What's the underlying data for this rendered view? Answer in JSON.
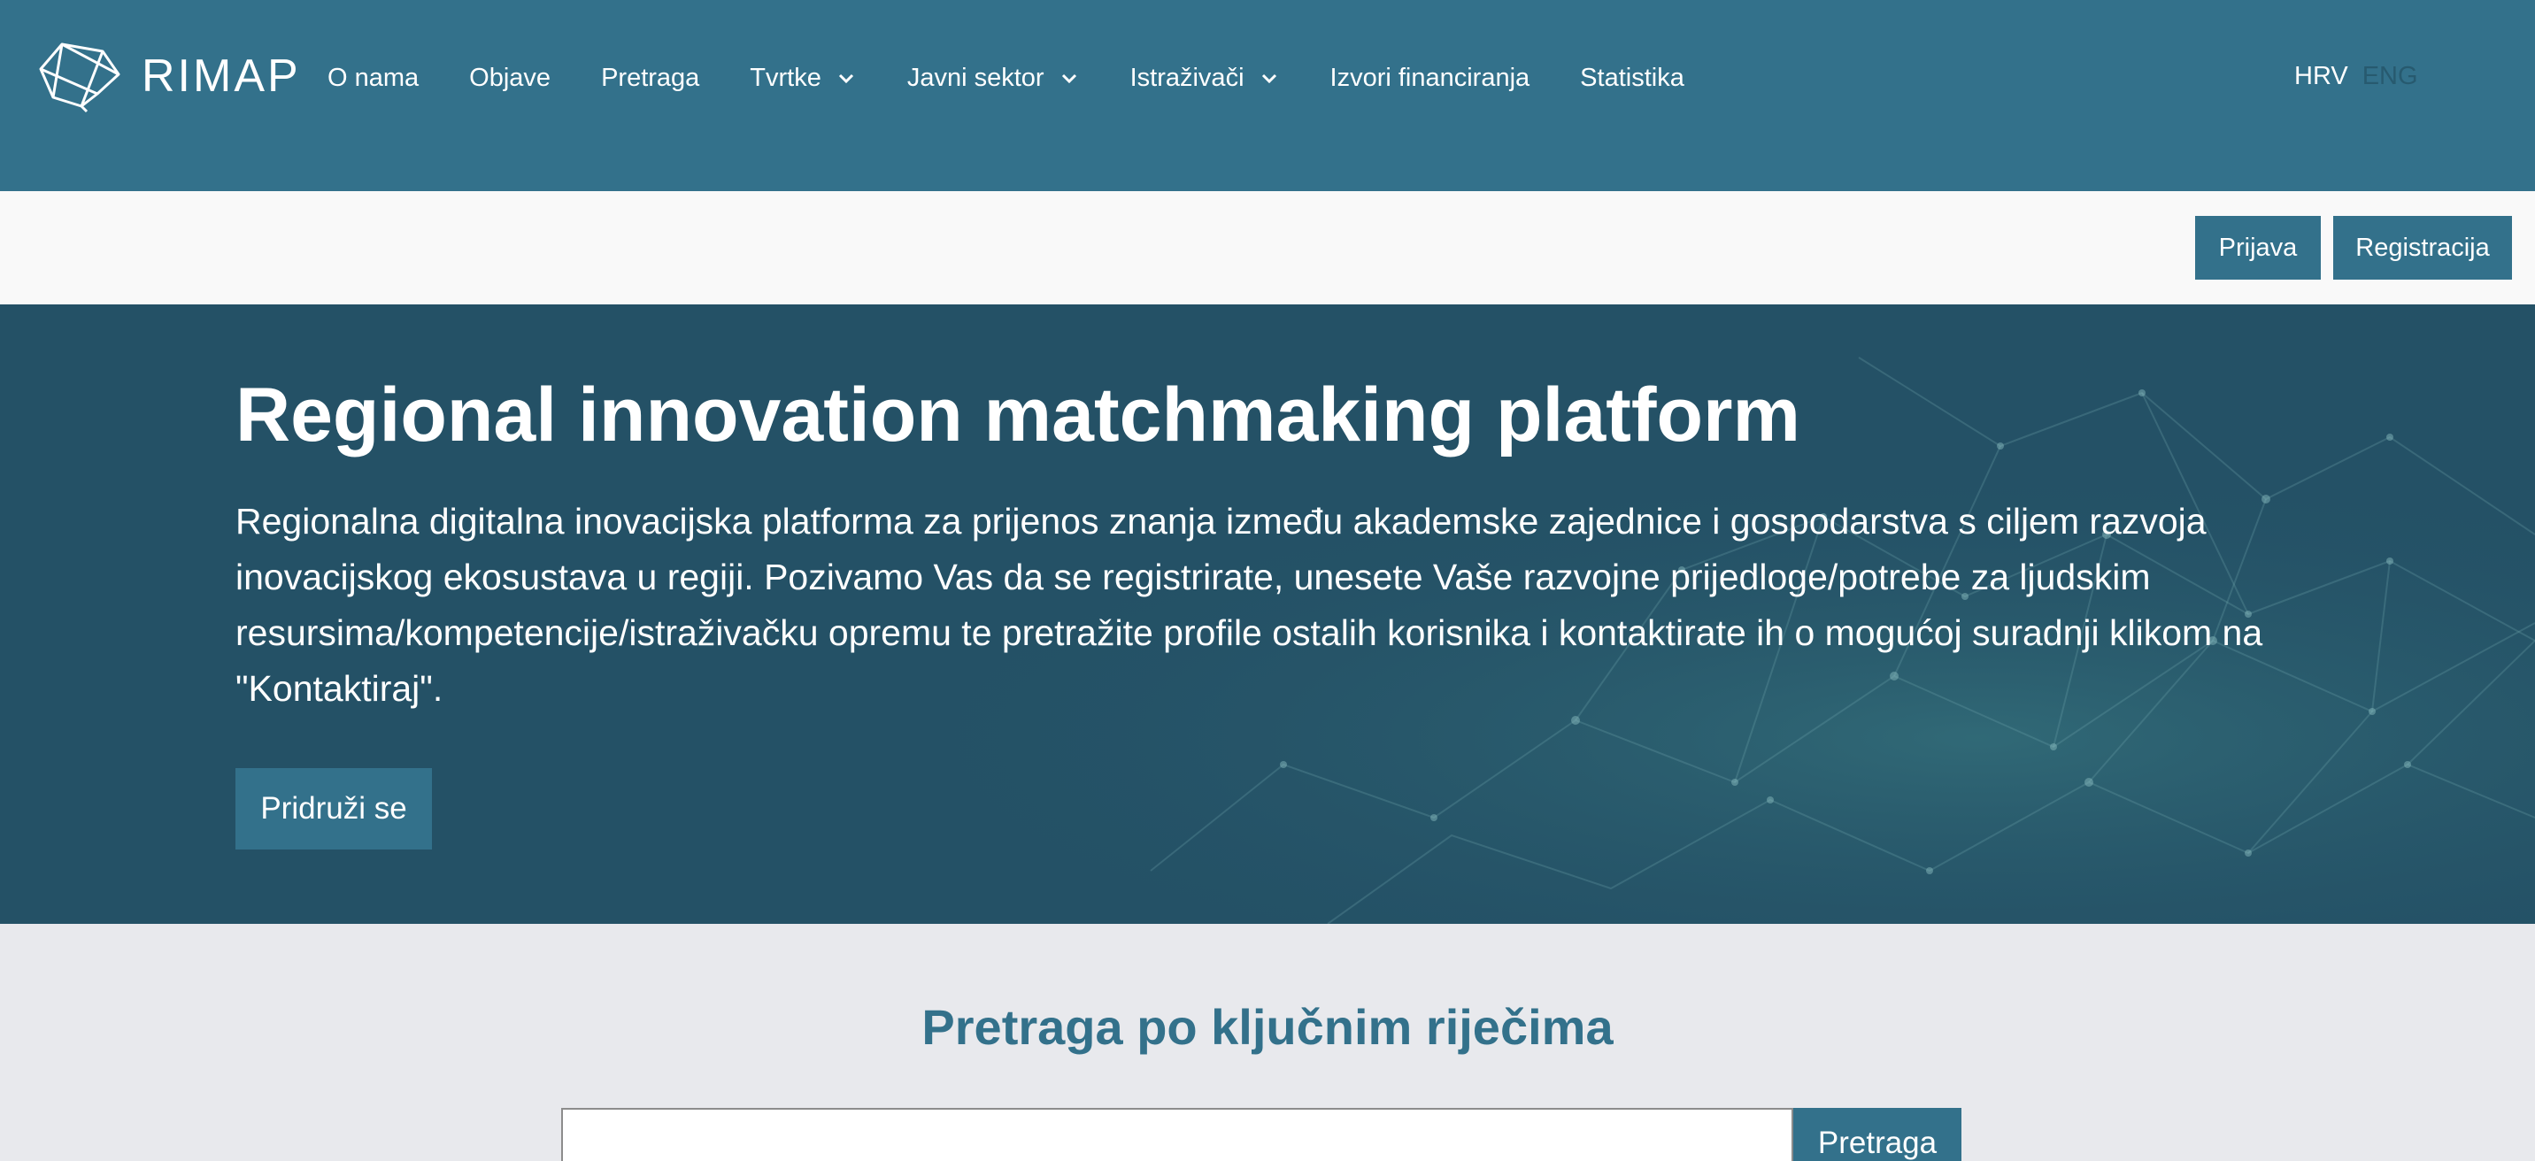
{
  "header": {
    "logo_text": "RIMAP",
    "nav": [
      {
        "label": "O nama",
        "dropdown": false
      },
      {
        "label": "Objave",
        "dropdown": false
      },
      {
        "label": "Pretraga",
        "dropdown": false
      },
      {
        "label": "Tvrtke",
        "dropdown": true
      },
      {
        "label": "Javni sektor",
        "dropdown": true
      },
      {
        "label": "Istraživači",
        "dropdown": true
      },
      {
        "label": "Izvori financiranja",
        "dropdown": false
      },
      {
        "label": "Statistika",
        "dropdown": false
      }
    ],
    "languages": {
      "active": "HRV",
      "inactive": "ENG"
    }
  },
  "auth": {
    "login_label": "Prijava",
    "register_label": "Registracija"
  },
  "hero": {
    "title": "Regional innovation matchmaking platform",
    "text": "Regionalna digitalna inovacijska platforma za prijenos znanja između akademske zajednice i gospodarstva s ciljem razvoja inovacijskog ekosustava u regiji. Pozivamo Vas da se registrirate, unesete Vaše razvojne prijedloge/potrebe za ljudskim resursima/kompetencije/istraživačku opremu te pretražite profile ostalih korisnika i kontaktirate ih o mogućoj suradnji klikom na \"Kontaktiraj\".",
    "join_label": "Pridruži se"
  },
  "search": {
    "title": "Pretraga po ključnim riječima",
    "input_value": "",
    "button_label": "Pretraga"
  },
  "colors": {
    "brand": "#33718b",
    "hero_bg": "#245166",
    "subbar_bg": "#f9f9f9",
    "page_bg": "#e8e9ed"
  }
}
